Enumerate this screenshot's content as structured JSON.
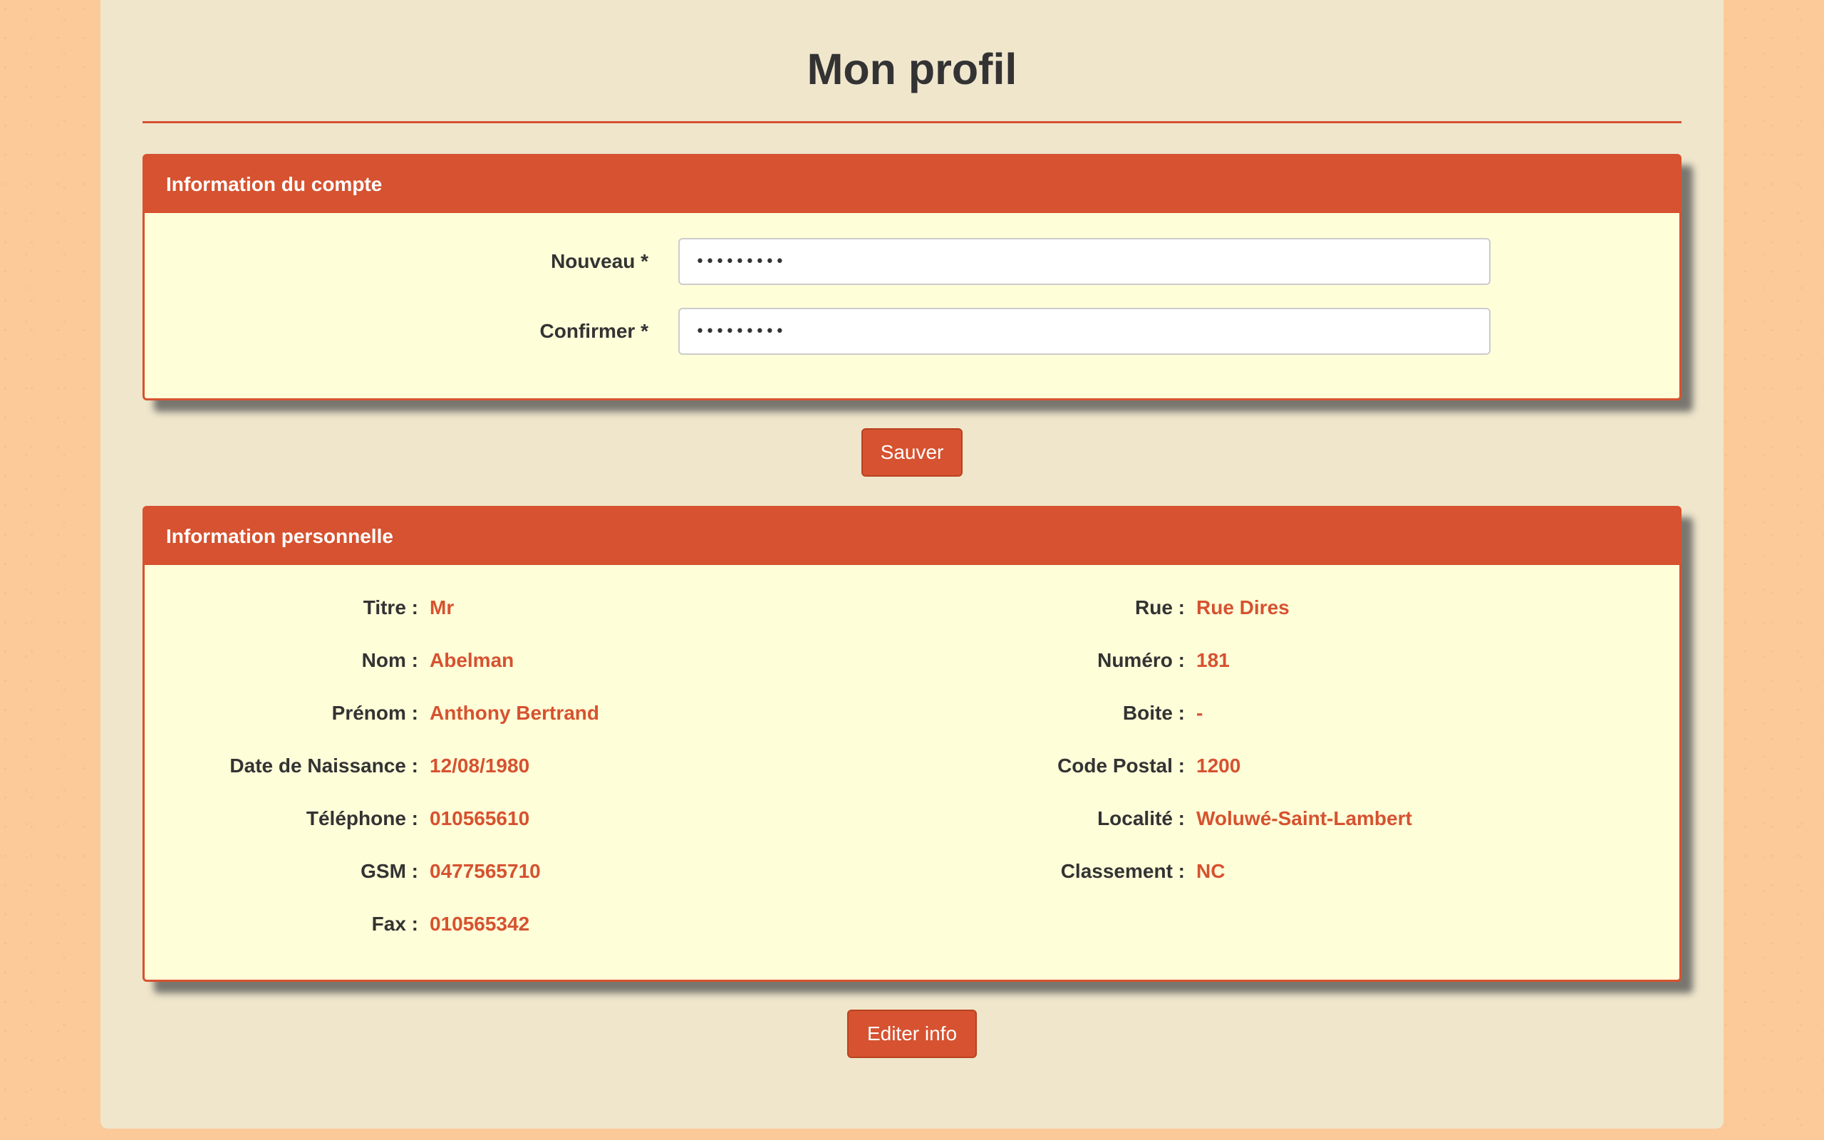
{
  "page": {
    "title": "Mon profil"
  },
  "account": {
    "heading": "Information du compte",
    "new_label": "Nouveau *",
    "new_value": "•••••••••",
    "confirm_label": "Confirmer *",
    "confirm_value": "•••••••••",
    "save_label": "Sauver"
  },
  "personal": {
    "heading": "Information personnelle",
    "left": [
      {
        "label": "Titre :",
        "value": "Mr"
      },
      {
        "label": "Nom :",
        "value": "Abelman"
      },
      {
        "label": "Prénom :",
        "value": "Anthony Bertrand"
      },
      {
        "label": "Date de Naissance :",
        "value": "12/08/1980"
      },
      {
        "label": "Téléphone :",
        "value": "010565610"
      },
      {
        "label": "GSM :",
        "value": "0477565710"
      },
      {
        "label": "Fax :",
        "value": "010565342"
      }
    ],
    "right": [
      {
        "label": "Rue :",
        "value": "Rue Dires"
      },
      {
        "label": "Numéro :",
        "value": "181"
      },
      {
        "label": "Boite :",
        "value": "-"
      },
      {
        "label": "Code Postal :",
        "value": "1200"
      },
      {
        "label": "Localité :",
        "value": "Woluwé-Saint-Lambert"
      },
      {
        "label": "Classement :",
        "value": "NC"
      }
    ],
    "edit_label": "Editer info"
  },
  "colors": {
    "accent": "#d65230",
    "panel_bg": "#fefed9",
    "container_bg": "#efe6cc",
    "page_bg": "#fcc999",
    "text": "#333333"
  }
}
